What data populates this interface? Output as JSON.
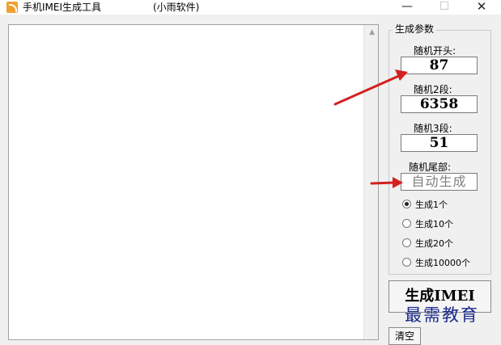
{
  "window": {
    "title": "手机IMEI生成工具",
    "subtitle": "(小雨软件)",
    "minimize_glyph": "—",
    "maximize_glyph": "☐",
    "close_glyph": "✕",
    "icon": "rss-icon"
  },
  "output": {
    "value": ""
  },
  "params": {
    "group_title": "生成参数",
    "fields": [
      {
        "label": "随机开头:",
        "value": "87"
      },
      {
        "label": "随机2段:",
        "value": "6358"
      },
      {
        "label": "随机3段:",
        "value": "51"
      },
      {
        "label": "随机尾部:",
        "value": "自动生成"
      }
    ],
    "options": [
      {
        "label": "生成1个",
        "checked": true
      },
      {
        "label": "生成10个",
        "checked": false
      },
      {
        "label": "生成20个",
        "checked": false
      },
      {
        "label": "生成10000个",
        "checked": false
      }
    ]
  },
  "actions": {
    "generate_label": "生成IMEI",
    "clear_label": "清空"
  },
  "watermark": "最需教育",
  "colors": {
    "arrow": "#d42020",
    "watermark": "#1a2a8c"
  }
}
